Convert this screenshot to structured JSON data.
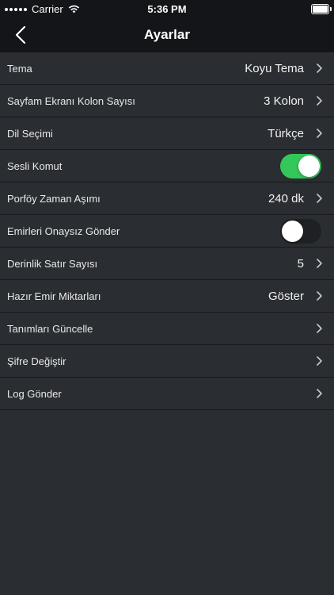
{
  "status_bar": {
    "carrier": "Carrier",
    "time": "5:36 PM"
  },
  "nav": {
    "title": "Ayarlar"
  },
  "settings": {
    "rows": [
      {
        "label": "Tema",
        "value": "Koyu Tema"
      },
      {
        "label": "Sayfam Ekranı Kolon Sayısı",
        "value": "3 Kolon"
      },
      {
        "label": "Dil Seçimi",
        "value": "Türkçe"
      },
      {
        "label": "Sesli Komut",
        "toggle": true
      },
      {
        "label": "Porföy Zaman Aşımı",
        "value": "240 dk"
      },
      {
        "label": "Emirleri Onaysız Gönder",
        "toggle": false
      },
      {
        "label": "Derinlik Satır Sayısı",
        "value": "5"
      },
      {
        "label": "Hazır Emir Miktarları",
        "value": "Göster"
      },
      {
        "label": "Tanımları Güncelle"
      },
      {
        "label": "Şifre Değiştir"
      },
      {
        "label": "Log Gönder"
      }
    ]
  },
  "colors": {
    "background": "#2a2d31",
    "header": "#141518",
    "toggle_on": "#34c759",
    "toggle_off": "#1e2023"
  }
}
